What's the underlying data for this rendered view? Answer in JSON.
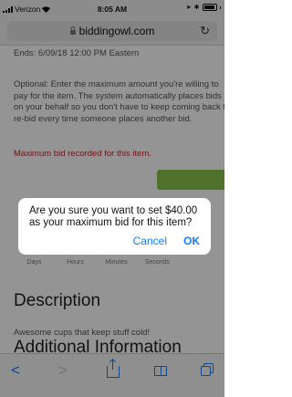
{
  "status_bar": {
    "carrier": "Verizon",
    "time": "8:05 AM"
  },
  "browser": {
    "url": "biddingowl.com",
    "reload_icon": "reload-icon",
    "toolbar_icons": [
      "back-icon",
      "forward-icon",
      "share-icon",
      "bookmarks-icon",
      "tabs-icon"
    ]
  },
  "page": {
    "ends_text": "Ends: 6/09/18 12:00 PM Eastern",
    "optional_text": "Optional: Enter the maximum amount you're willing to pay for the item. The system automatically places bids on your behalf so you don't have to keep coming back to re-bid every time someone places another bid.",
    "max_bid_recorded": "Maximum bid recorded for this item.",
    "countdown_labels": [
      "Days",
      "Hours",
      "Minutes",
      "Seconds"
    ],
    "description_heading": "Description",
    "description_text": "Awesome cups that keep stuff cold!",
    "additional_heading": "Additional Information"
  },
  "dialog": {
    "message": "Are you sure you want to set $40.00 as your maximum bid for this item?",
    "cancel_label": "Cancel",
    "ok_label": "OK"
  },
  "colors": {
    "accent": "#1a7cf6",
    "alert_text": "#c0262d",
    "bid_button": "#8bc34a"
  }
}
